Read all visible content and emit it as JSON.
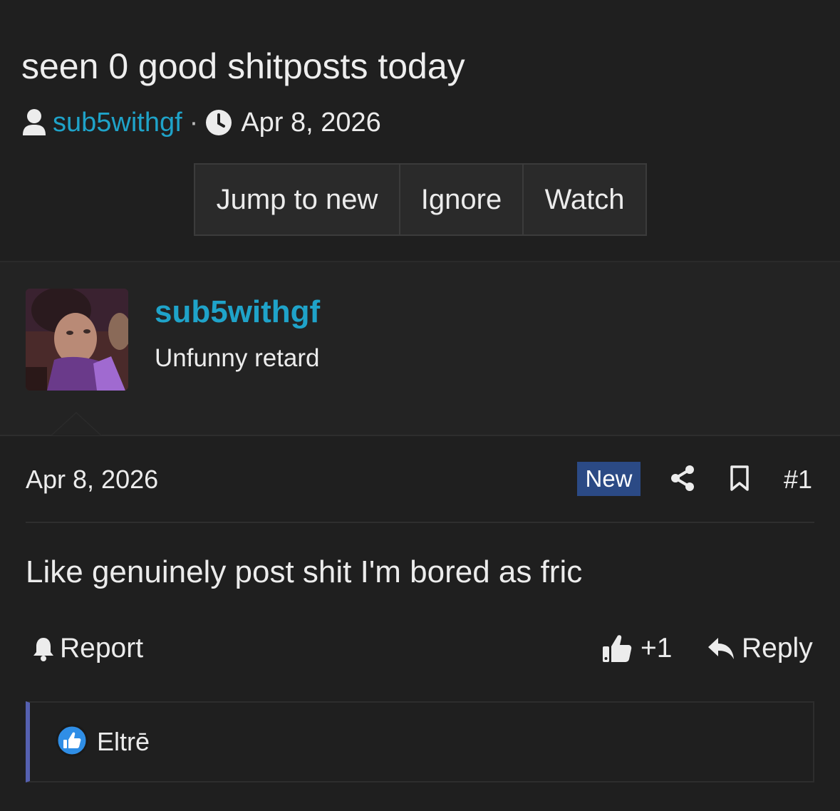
{
  "thread": {
    "title": "seen 0 good shitposts today",
    "author": "sub5withgf",
    "separator": "·",
    "date": "Apr 8, 2026",
    "buttons": {
      "jump": "Jump to new",
      "ignore": "Ignore",
      "watch": "Watch"
    }
  },
  "post": {
    "username": "sub5withgf",
    "user_title": "Unfunny retard",
    "date": "Apr 8, 2026",
    "badge": "New",
    "number": "#1",
    "body": "Like genuinely post shit I'm bored as fric",
    "actions": {
      "report": "Report",
      "like_count": "+1",
      "reply": "Reply"
    },
    "reactions": {
      "user": "Eltrē"
    }
  },
  "colors": {
    "accent": "#1fa3c9",
    "badge": "#2b4a85",
    "reaction_bar": "#5560b0",
    "like_blue": "#2f8ee6"
  },
  "icons": [
    "user-icon",
    "clock-icon",
    "share-icon",
    "bookmark-icon",
    "bell-icon",
    "thumb-up-icon",
    "reply-icon",
    "like-reaction-icon"
  ]
}
